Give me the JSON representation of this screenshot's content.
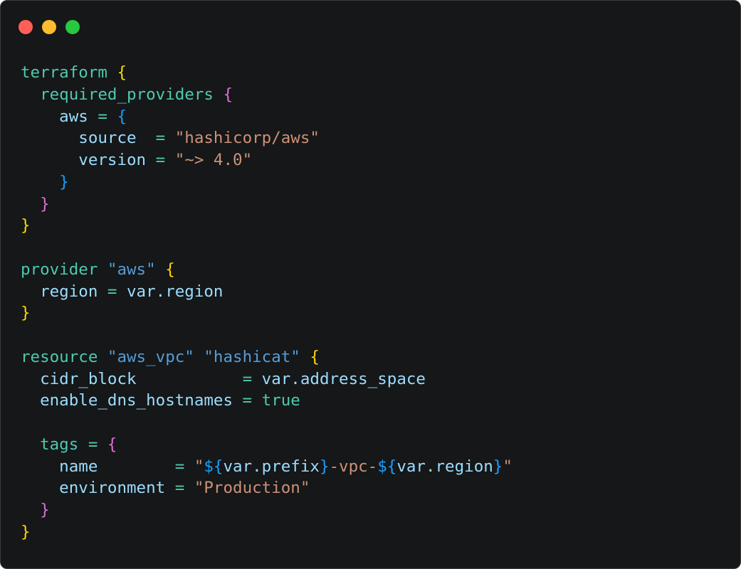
{
  "window": {
    "buttons": [
      {
        "name": "close",
        "color": "#ff5f57"
      },
      {
        "name": "minimize",
        "color": "#febc2e"
      },
      {
        "name": "zoom",
        "color": "#28c840"
      }
    ]
  },
  "palette": {
    "keyword": "#4ec9b0",
    "string": "#ce9178",
    "label": "#569cd6",
    "ident": "#9cdcfe",
    "brace1": "#ffd700",
    "brace2": "#da70d6",
    "brace3": "#179fff",
    "plain": "#d4d4d4"
  },
  "code_lines": [
    [
      {
        "t": "terraform",
        "c": "keyword"
      },
      {
        "t": " ",
        "c": "plain"
      },
      {
        "t": "{",
        "c": "brace1"
      }
    ],
    [
      {
        "t": "  required_providers",
        "c": "keyword"
      },
      {
        "t": " ",
        "c": "plain"
      },
      {
        "t": "{",
        "c": "brace2"
      }
    ],
    [
      {
        "t": "    aws",
        "c": "ident"
      },
      {
        "t": " = ",
        "c": "keyword"
      },
      {
        "t": "{",
        "c": "brace3"
      }
    ],
    [
      {
        "t": "      source",
        "c": "ident"
      },
      {
        "t": "  = ",
        "c": "keyword"
      },
      {
        "t": "\"hashicorp/aws\"",
        "c": "string"
      }
    ],
    [
      {
        "t": "      version",
        "c": "ident"
      },
      {
        "t": " = ",
        "c": "keyword"
      },
      {
        "t": "\"~> 4.0\"",
        "c": "string"
      }
    ],
    [
      {
        "t": "    ",
        "c": "plain"
      },
      {
        "t": "}",
        "c": "brace3"
      }
    ],
    [
      {
        "t": "  ",
        "c": "plain"
      },
      {
        "t": "}",
        "c": "brace2"
      }
    ],
    [
      {
        "t": "}",
        "c": "brace1"
      }
    ],
    [],
    [
      {
        "t": "provider",
        "c": "keyword"
      },
      {
        "t": " ",
        "c": "plain"
      },
      {
        "t": "\"aws\"",
        "c": "label"
      },
      {
        "t": " ",
        "c": "plain"
      },
      {
        "t": "{",
        "c": "brace1"
      }
    ],
    [
      {
        "t": "  region",
        "c": "ident"
      },
      {
        "t": " = ",
        "c": "keyword"
      },
      {
        "t": "var.region",
        "c": "ident"
      }
    ],
    [
      {
        "t": "}",
        "c": "brace1"
      }
    ],
    [],
    [
      {
        "t": "resource",
        "c": "keyword"
      },
      {
        "t": " ",
        "c": "plain"
      },
      {
        "t": "\"aws_vpc\"",
        "c": "label"
      },
      {
        "t": " ",
        "c": "plain"
      },
      {
        "t": "\"hashicat\"",
        "c": "label"
      },
      {
        "t": " ",
        "c": "plain"
      },
      {
        "t": "{",
        "c": "brace1"
      }
    ],
    [
      {
        "t": "  cidr_block",
        "c": "ident"
      },
      {
        "t": "           = ",
        "c": "keyword"
      },
      {
        "t": "var.address_space",
        "c": "ident"
      }
    ],
    [
      {
        "t": "  enable_dns_hostnames",
        "c": "ident"
      },
      {
        "t": " = ",
        "c": "keyword"
      },
      {
        "t": "true",
        "c": "keyword"
      }
    ],
    [],
    [
      {
        "t": "  tags",
        "c": "keyword"
      },
      {
        "t": " = ",
        "c": "keyword"
      },
      {
        "t": "{",
        "c": "brace2"
      }
    ],
    [
      {
        "t": "    name",
        "c": "ident"
      },
      {
        "t": "        = ",
        "c": "keyword"
      },
      {
        "t": "\"",
        "c": "string"
      },
      {
        "t": "${",
        "c": "brace3"
      },
      {
        "t": "var.prefix",
        "c": "ident"
      },
      {
        "t": "}",
        "c": "brace3"
      },
      {
        "t": "-vpc-",
        "c": "string"
      },
      {
        "t": "${",
        "c": "brace3"
      },
      {
        "t": "var.region",
        "c": "ident"
      },
      {
        "t": "}",
        "c": "brace3"
      },
      {
        "t": "\"",
        "c": "string"
      }
    ],
    [
      {
        "t": "    environment",
        "c": "ident"
      },
      {
        "t": " = ",
        "c": "keyword"
      },
      {
        "t": "\"Production\"",
        "c": "string"
      }
    ],
    [
      {
        "t": "  ",
        "c": "plain"
      },
      {
        "t": "}",
        "c": "brace2"
      }
    ],
    [
      {
        "t": "}",
        "c": "brace1"
      }
    ]
  ]
}
